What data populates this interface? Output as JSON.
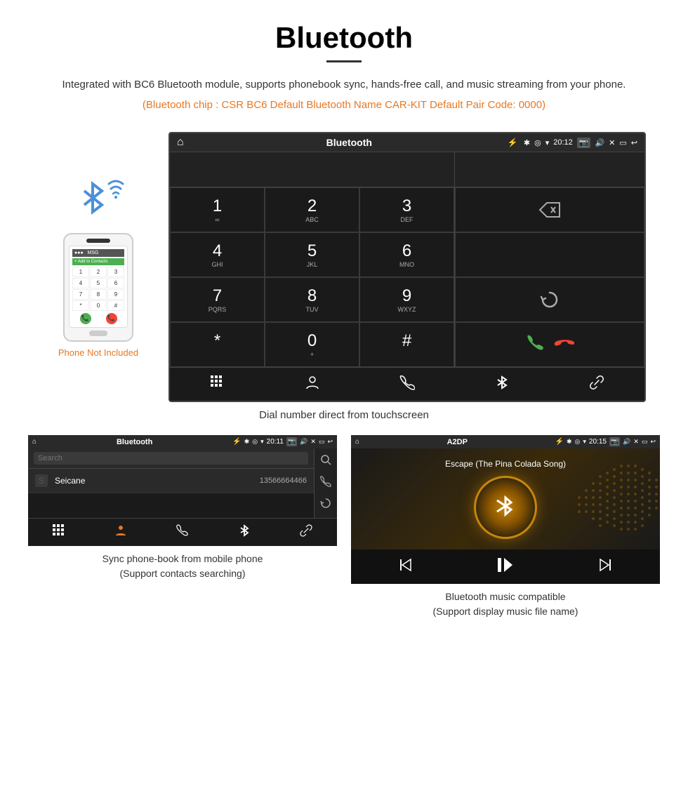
{
  "header": {
    "title": "Bluetooth",
    "subtitle": "Integrated with BC6 Bluetooth module, supports phonebook sync, hands-free call, and music streaming from your phone.",
    "chip_info": "(Bluetooth chip : CSR BC6    Default Bluetooth Name CAR-KIT    Default Pair Code: 0000)"
  },
  "phone_side": {
    "not_included": "Phone Not Included",
    "keypad": [
      "1",
      "2",
      "3",
      "4",
      "5",
      "6",
      "7",
      "8",
      "9",
      "*",
      "0",
      "#"
    ]
  },
  "car_display": {
    "status_bar": {
      "title": "Bluetooth",
      "time": "20:12"
    },
    "dial_keys": [
      {
        "num": "1",
        "letters": "∞"
      },
      {
        "num": "2",
        "letters": "ABC"
      },
      {
        "num": "3",
        "letters": "DEF"
      },
      {
        "num": "4",
        "letters": "GHI"
      },
      {
        "num": "5",
        "letters": "JKL"
      },
      {
        "num": "6",
        "letters": "MNO"
      },
      {
        "num": "7",
        "letters": "PQRS"
      },
      {
        "num": "8",
        "letters": "TUV"
      },
      {
        "num": "9",
        "letters": "WXYZ"
      },
      {
        "num": "*",
        "letters": ""
      },
      {
        "num": "0",
        "letters": "+"
      },
      {
        "num": "#",
        "letters": ""
      }
    ]
  },
  "dial_caption": "Dial number direct from touchscreen",
  "phonebook_panel": {
    "status_bar_title": "Bluetooth",
    "time": "20:11",
    "search_placeholder": "Search",
    "contact_letter": "S",
    "contact_name": "Seicane",
    "contact_number": "13566664466",
    "caption_line1": "Sync phone-book from mobile phone",
    "caption_line2": "(Support contacts searching)"
  },
  "music_panel": {
    "status_bar_title": "A2DP",
    "time": "20:15",
    "song_title": "Escape (The Pina Colada Song)",
    "caption_line1": "Bluetooth music compatible",
    "caption_line2": "(Support display music file name)"
  }
}
